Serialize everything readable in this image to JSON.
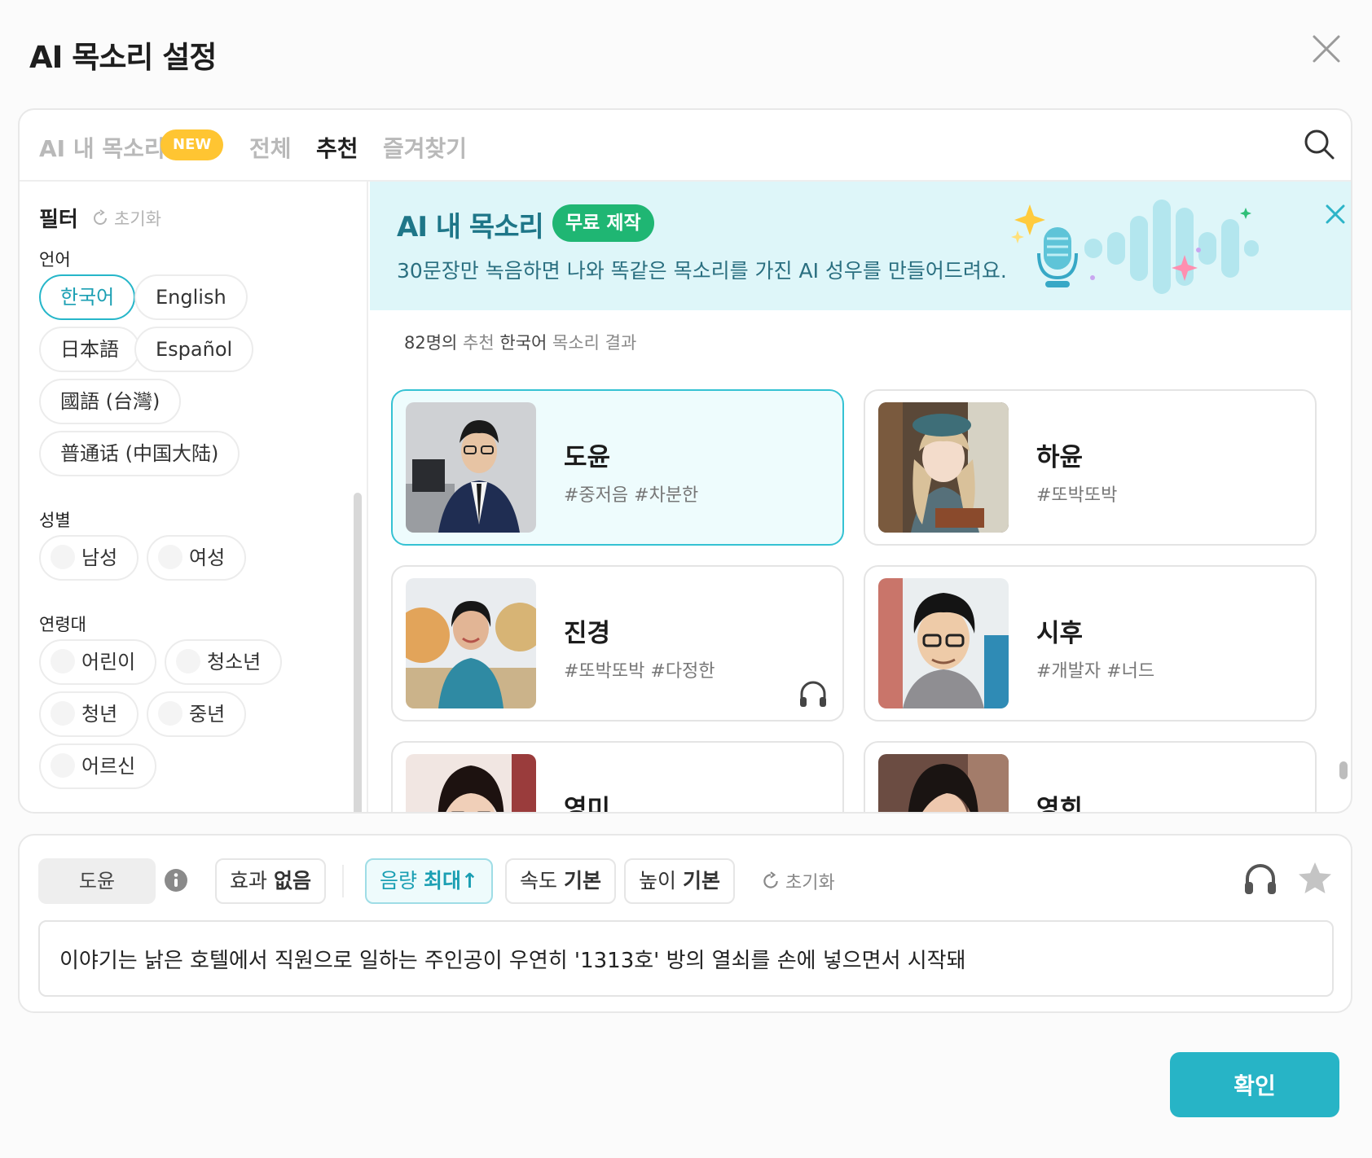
{
  "modal": {
    "title": "AI 목소리 설정"
  },
  "tabs": [
    {
      "label": "AI 내 목소리",
      "badge": "NEW"
    },
    {
      "label": "전체"
    },
    {
      "label": "추천",
      "active": true
    },
    {
      "label": "즐겨찾기"
    }
  ],
  "filter": {
    "title": "필터",
    "reset_label": "초기화",
    "language_label": "언어",
    "languages": [
      "한국어",
      "English",
      "日本語",
      "Español",
      "國語 (台灣)",
      "普通话 (中国大陆)"
    ],
    "selected_language": "한국어",
    "gender_label": "성별",
    "genders": [
      "남성",
      "여성"
    ],
    "age_label": "연령대",
    "ages": [
      "어린이",
      "청소년",
      "청년",
      "중년",
      "어르신"
    ]
  },
  "banner": {
    "title": "AI 내 목소리",
    "badge": "무료 제작",
    "description": "30문장만 녹음하면 나와 똑같은 목소리를 가진 AI 성우를 만들어드려요."
  },
  "results": {
    "count": "82명의",
    "mid": " 추천 ",
    "lang": "한국어",
    "suffix": " 목소리 결과"
  },
  "voices": [
    {
      "name": "도윤",
      "tags": "#중저음 #차분한",
      "selected": true
    },
    {
      "name": "하윤",
      "tags": "#또박또박"
    },
    {
      "name": "진경",
      "tags": "#또박또박 #다정한"
    },
    {
      "name": "시후",
      "tags": "#개발자 #너드"
    },
    {
      "name": "영미",
      "tags": ""
    },
    {
      "name": "영희",
      "tags": ""
    }
  ],
  "settings": {
    "voice_name": "도윤",
    "effect": {
      "label": "효과",
      "value": "없음"
    },
    "volume": {
      "label": "음량",
      "value": "최대",
      "arrow": "↑"
    },
    "speed": {
      "label": "속도",
      "value": "기본"
    },
    "pitch": {
      "label": "높이",
      "value": "기본"
    },
    "reset_label": "초기화"
  },
  "script_text": "이야기는 낡은 호텔에서 직원으로 일하는 주인공이 우연히 '1313호' 방의 열쇠를 손에 넣으면서 시작돼",
  "confirm_label": "확인",
  "colors": {
    "accent": "#27b4c6",
    "badge_new": "#ffc532",
    "badge_free": "#1fb673",
    "banner_bg": "#def6f9"
  }
}
